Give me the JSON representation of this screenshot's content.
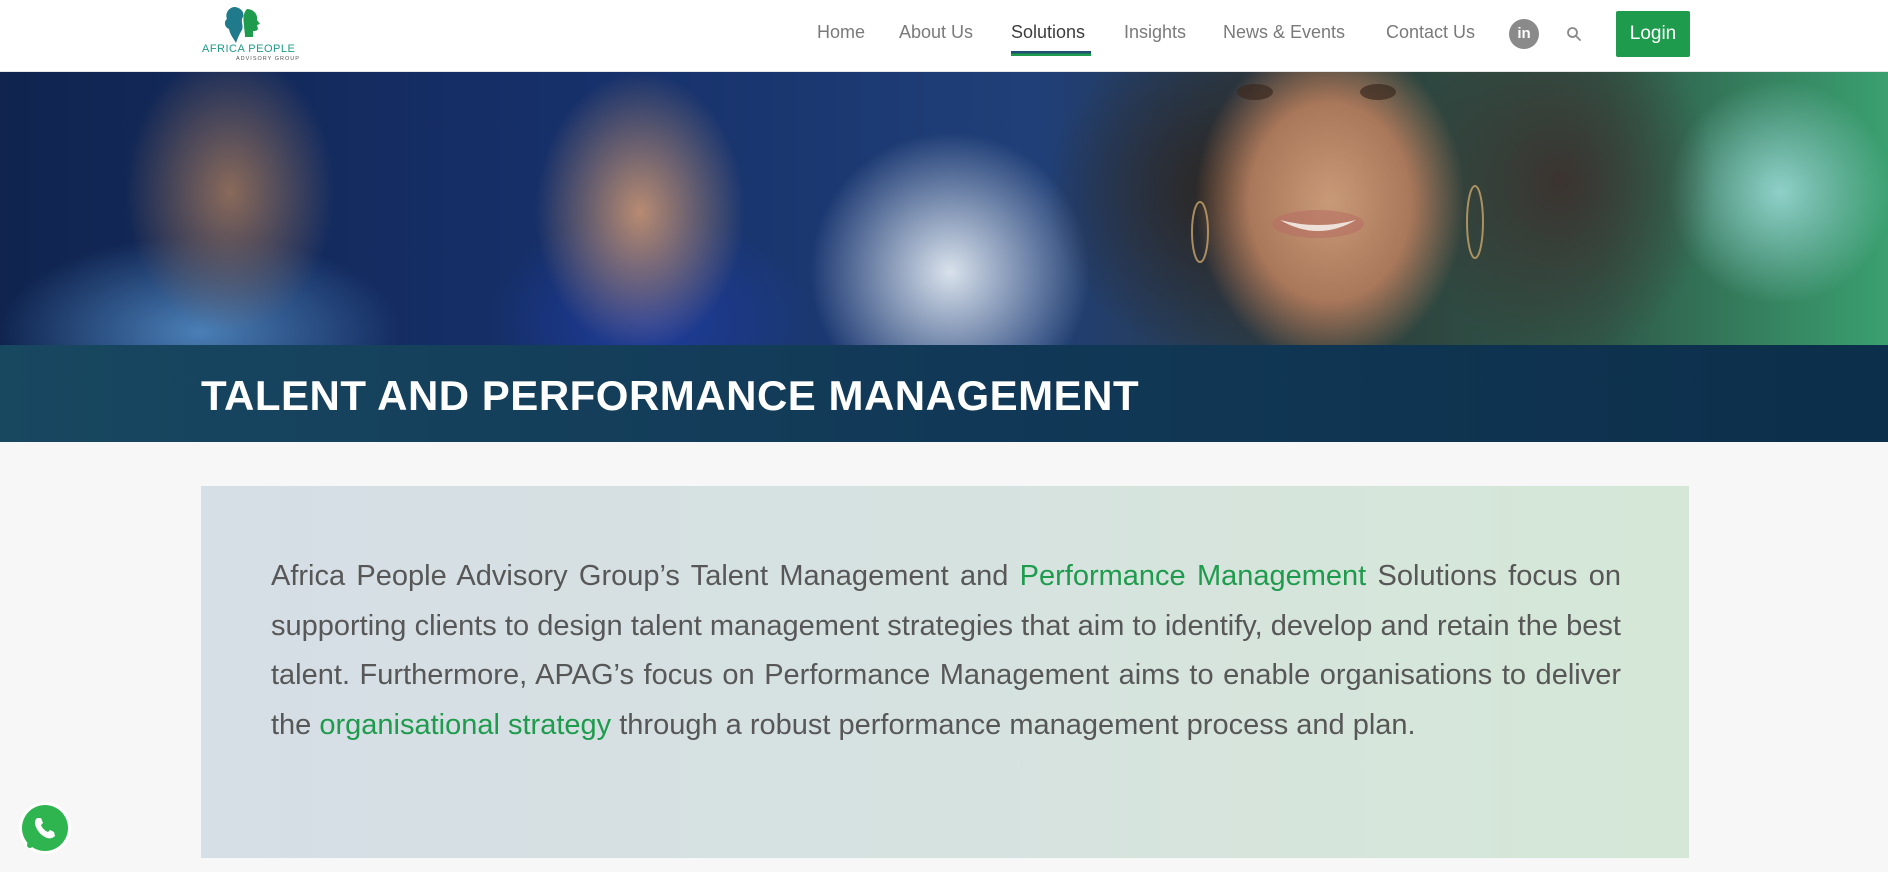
{
  "header": {
    "logo": {
      "brand": "AFRICA PEOPLE",
      "tagline": "ADVISORY GROUP",
      "icon": "africa-profile-logo"
    },
    "nav": [
      {
        "label": "Home",
        "active": false
      },
      {
        "label": "About Us",
        "active": false
      },
      {
        "label": "Solutions",
        "active": true
      },
      {
        "label": "Insights",
        "active": false
      },
      {
        "label": "News & Events",
        "active": false
      },
      {
        "label": "Contact Us",
        "active": false
      }
    ],
    "linkedin_label": "in",
    "search_icon": "search-icon",
    "login_label": "Login"
  },
  "hero": {
    "image": "blurred-people-background-smiling-woman"
  },
  "page": {
    "title": "TALENT AND PERFORMANCE MANAGEMENT"
  },
  "content": {
    "part1": "Africa People Advisory Group’s Talent Management and ",
    "link1": "Performance Management",
    "part2": " Solutions focus on supporting clients to design talent management strategies that aim to identify, develop and retain the best talent. Furthermore, APAG’s focus on Performance Management aims to enable organisations to deliver the ",
    "link2": "organisational strategy",
    "part3": " through a robust performance management process and plan."
  },
  "floating": {
    "whatsapp_icon": "whatsapp-icon"
  },
  "colors": {
    "accent_green": "#1f9b4d",
    "title_band": "#113957",
    "nav_text": "#7a7a7a"
  }
}
